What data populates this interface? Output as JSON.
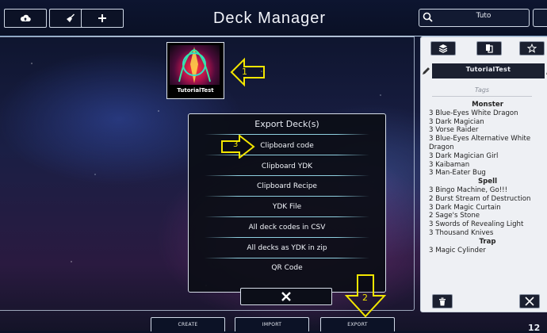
{
  "header": {
    "title": "Deck Manager",
    "search_value": "Tuto",
    "buttons": [
      {
        "icon": "cloud-upload-icon"
      },
      {
        "icon": "broom-icon"
      },
      {
        "icon": "plus-icon"
      }
    ]
  },
  "deck": {
    "name": "TutorialTest"
  },
  "export_dialog": {
    "title": "Export Deck(s)",
    "options": [
      "Clipboard code",
      "Clipboard YDK",
      "Clipboard Recipe",
      "YDK File",
      "All deck codes in CSV",
      "All decks as YDK in zip",
      "QR Code"
    ],
    "close_icon": "close-icon"
  },
  "bottom_buttons": [
    "CREATE",
    "IMPORT",
    "EXPORT"
  ],
  "page_number": "12",
  "panel": {
    "deck_name": "TutorialTest",
    "tags_placeholder": "Tags",
    "sections": [
      {
        "title": "Monster",
        "cards": [
          "3 Blue-Eyes White Dragon",
          "3 Dark Magician",
          "3 Vorse Raider",
          "3 Blue-Eyes Alternative White Dragon",
          "3 Dark Magician Girl",
          "3 Kaibaman",
          "3 Man-Eater Bug"
        ]
      },
      {
        "title": "Spell",
        "cards": [
          "3 Bingo Machine, Go!!!",
          "2 Burst Stream of Destruction",
          "3 Dark Magic Curtain",
          "2 Sage's Stone",
          "3 Swords of Revealing Light",
          "3 Thousand Knives"
        ]
      },
      {
        "title": "Trap",
        "cards": [
          "3 Magic Cylinder"
        ]
      }
    ]
  },
  "annotations": [
    "1",
    "2",
    "3"
  ],
  "colors": {
    "annotation_yellow": "#f3e600",
    "panel_bg": "#eef0f4",
    "dark_ui": "#0c1226"
  }
}
